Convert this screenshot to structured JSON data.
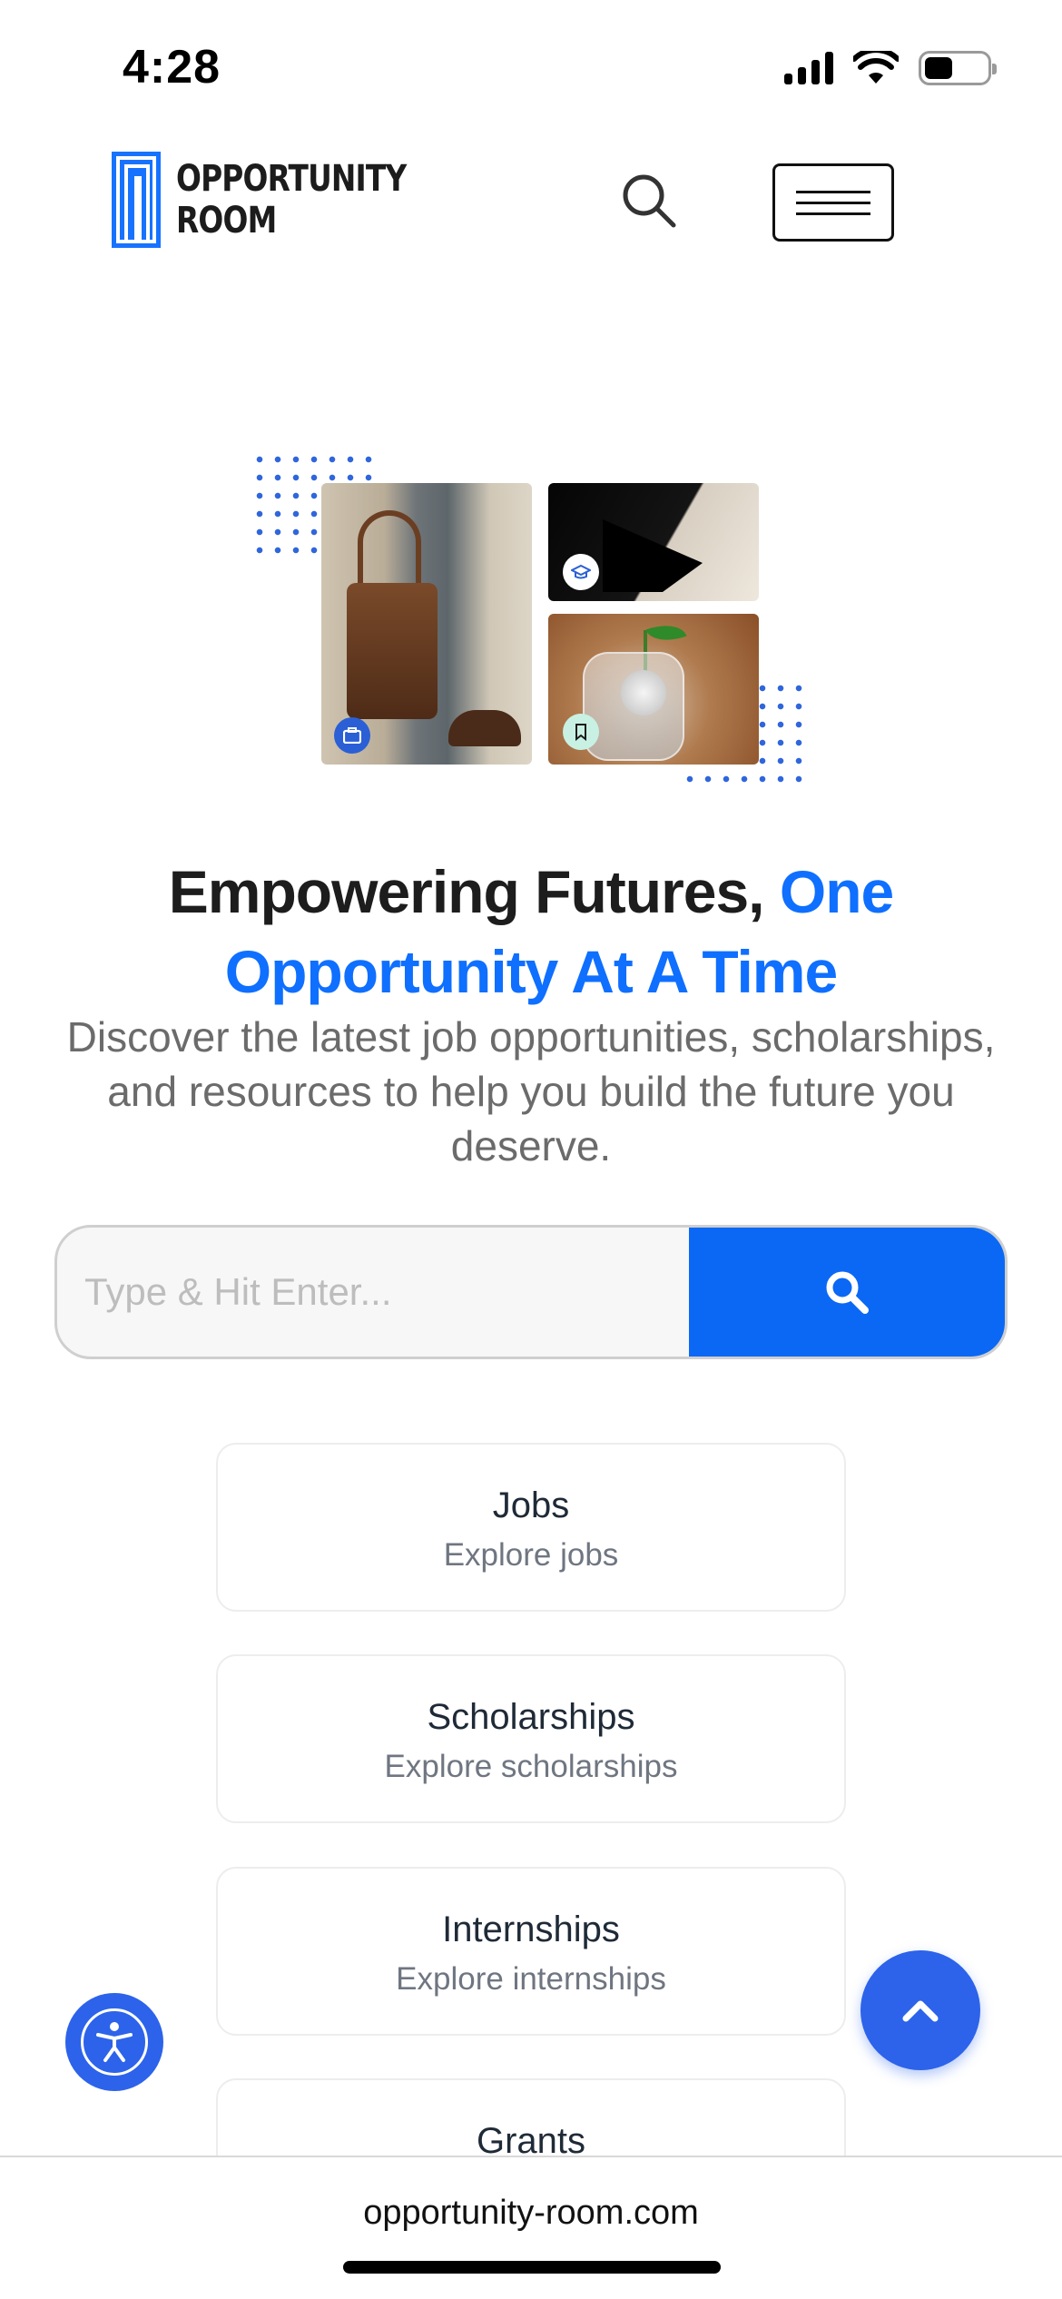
{
  "status_bar": {
    "time": "4:28"
  },
  "header": {
    "logo_line1": "OPPORTUNITY",
    "logo_line2": "ROOM",
    "brand_color": "#0f6fff"
  },
  "hero": {
    "headline_part1": "Empowering Futures, ",
    "headline_accent_line1": "One",
    "headline_accent_line2": "Opportunity At A Time",
    "subtitle": "Discover the latest job opportunities, scholarships, and resources to help you build the future you deserve."
  },
  "search": {
    "placeholder": "Type & Hit Enter...",
    "value": "",
    "button_color": "#0a68f5"
  },
  "categories": [
    {
      "title": "Jobs",
      "subtitle": "Explore jobs"
    },
    {
      "title": "Scholarships",
      "subtitle": "Explore scholarships"
    },
    {
      "title": "Internships",
      "subtitle": "Explore internships"
    },
    {
      "title": "Grants",
      "subtitle": ""
    }
  ],
  "icons": {
    "search": "search-icon",
    "menu": "hamburger-menu-icon",
    "accessibility": "accessibility-icon",
    "scroll_top": "chevron-up-icon"
  },
  "browser": {
    "url": "opportunity-room.com"
  }
}
